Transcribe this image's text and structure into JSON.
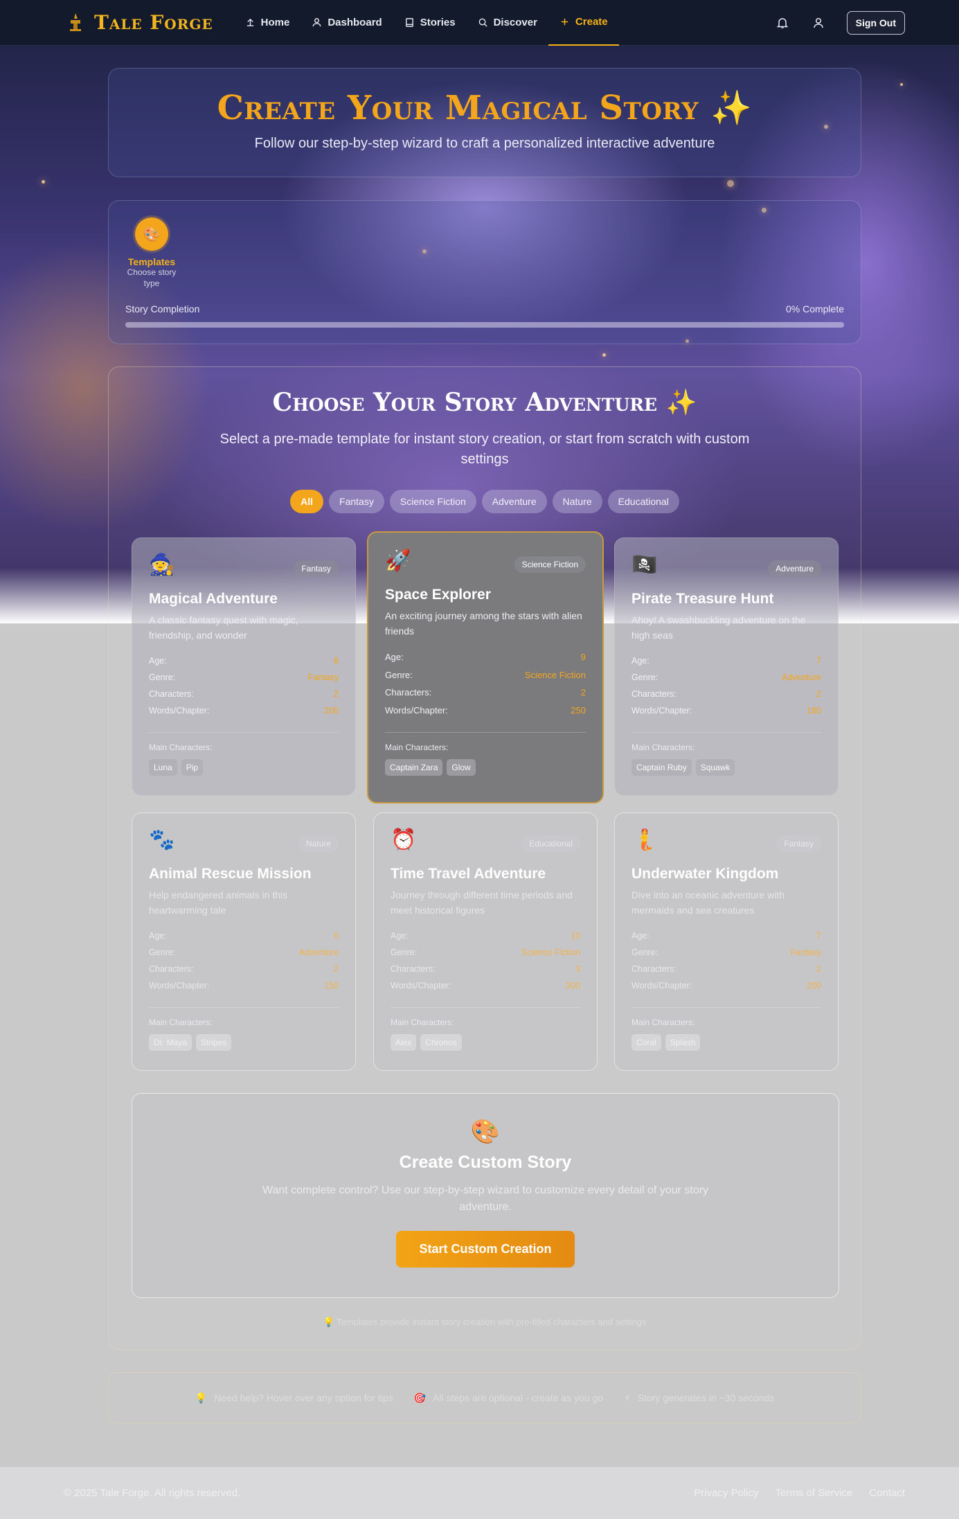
{
  "nav": {
    "brand": "Tale Forge",
    "links": [
      {
        "label": "Home",
        "icon": "home-icon"
      },
      {
        "label": "Dashboard",
        "icon": "user-icon"
      },
      {
        "label": "Stories",
        "icon": "book-icon"
      },
      {
        "label": "Discover",
        "icon": "search-icon"
      },
      {
        "label": "Create",
        "icon": "plus-icon",
        "active": true
      }
    ],
    "sign_out": "Sign Out"
  },
  "header": {
    "title": "Create Your Magical Story ✨",
    "subtitle": "Follow our step-by-step wizard to craft a personalized interactive adventure"
  },
  "wizard": {
    "step": {
      "icon": "🎨",
      "label": "Templates",
      "desc": "Choose story type"
    },
    "completion_label": "Story Completion",
    "completion_value": "0% Complete",
    "progress": 0
  },
  "templates": {
    "title": "Choose Your Story Adventure ✨",
    "subtitle": "Select a pre-made template for instant story creation, or start from scratch with custom settings",
    "filters": [
      "All",
      "Fantasy",
      "Science Fiction",
      "Adventure",
      "Nature",
      "Educational"
    ],
    "stat_labels": {
      "age": "Age:",
      "genre": "Genre:",
      "characters": "Characters:",
      "words": "Words/Chapter:"
    },
    "main_characters_label": "Main Characters:",
    "cards": [
      {
        "emoji": "🧙",
        "badge": "Fantasy",
        "title": "Magical Adventure",
        "desc": "A classic fantasy quest with magic, friendship, and wonder",
        "age": "8",
        "genre": "Fantasy",
        "characters": "2",
        "words": "200",
        "chars": [
          "Luna",
          "Pip"
        ]
      },
      {
        "emoji": "🚀",
        "badge": "Science Fiction",
        "title": "Space Explorer",
        "desc": "An exciting journey among the stars with alien friends",
        "age": "9",
        "genre": "Science Fiction",
        "characters": "2",
        "words": "250",
        "chars": [
          "Captain Zara",
          "Glow"
        ]
      },
      {
        "emoji": "🏴‍☠️",
        "badge": "Adventure",
        "title": "Pirate Treasure Hunt",
        "desc": "Ahoy! A swashbuckling adventure on the high seas",
        "age": "7",
        "genre": "Adventure",
        "characters": "2",
        "words": "180",
        "chars": [
          "Captain Ruby",
          "Squawk"
        ]
      },
      {
        "emoji": "🐾",
        "badge": "Nature",
        "title": "Animal Rescue Mission",
        "desc": "Help endangered animals in this heartwarming tale",
        "age": "6",
        "genre": "Adventure",
        "characters": "2",
        "words": "150",
        "chars": [
          "Dr. Maya",
          "Stripes"
        ]
      },
      {
        "emoji": "⏰",
        "badge": "Educational",
        "title": "Time Travel Adventure",
        "desc": "Journey through different time periods and meet historical figures",
        "age": "10",
        "genre": "Science Fiction",
        "characters": "3",
        "words": "300",
        "chars": [
          "Alex",
          "Chronos"
        ]
      },
      {
        "emoji": "🧜",
        "badge": "Fantasy",
        "title": "Underwater Kingdom",
        "desc": "Dive into an oceanic adventure with mermaids and sea creatures",
        "age": "7",
        "genre": "Fantasy",
        "characters": "2",
        "words": "200",
        "chars": [
          "Coral",
          "Splash"
        ]
      }
    ]
  },
  "custom": {
    "emoji": "🎨",
    "title": "Create Custom Story",
    "desc": "Want complete control? Use our step-by-step wizard to customize every detail of your story adventure.",
    "button": "Start Custom Creation"
  },
  "tip": "💡 Templates provide instant story creation with pre-filled characters and settings",
  "help": [
    {
      "icon": "💡",
      "text": "Need help? Hover over any option for tips"
    },
    {
      "icon": "🎯",
      "text": "All steps are optional - create as you go"
    },
    {
      "icon": "⚡",
      "text": "Story generates in ~30 seconds"
    }
  ],
  "footer": {
    "copyright": "© 2025 Tale Forge. All rights reserved.",
    "links": [
      "Privacy Policy",
      "Terms of Service",
      "Contact"
    ]
  },
  "colors": {
    "accent": "#f3a51c",
    "nav_bg": "#131a2b"
  }
}
